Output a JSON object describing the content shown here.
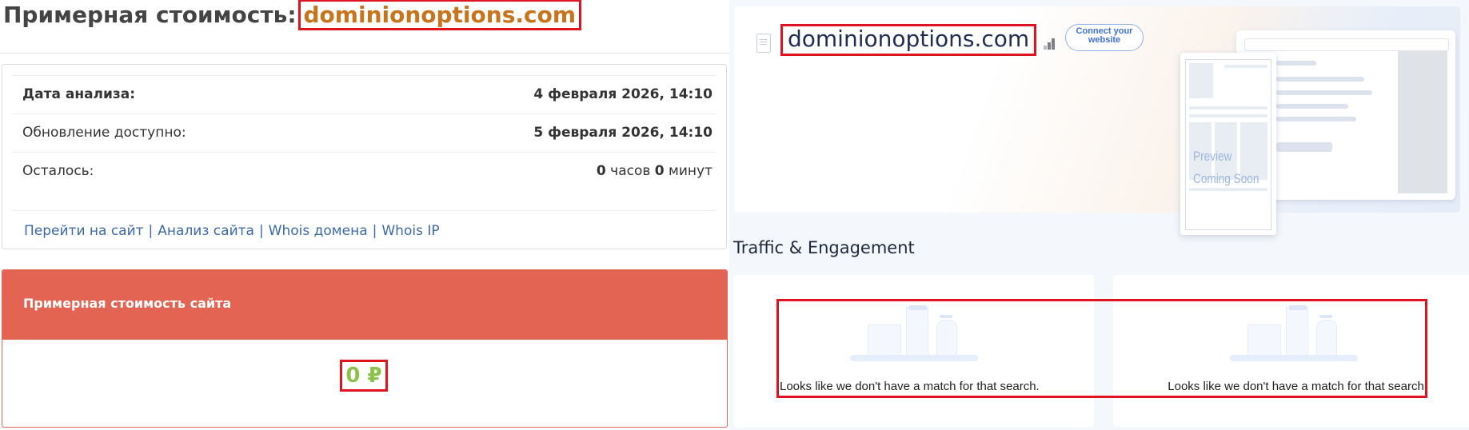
{
  "left_panel": {
    "title_prefix": "Примерная стоимость:",
    "title_domain": "dominionoptions.com",
    "info": {
      "rows": [
        {
          "label": "Дата анализа:",
          "value": "4 февраля 2026, 14:10"
        },
        {
          "label": "Обновление доступно:",
          "value": "5 февраля 2026, 14:10"
        }
      ],
      "remaining_label": "Осталось:",
      "remaining_hours": "0",
      "remaining_hours_unit": "часов",
      "remaining_minutes": "0",
      "remaining_minutes_unit": "минут"
    },
    "links": [
      "Перейти на сайт",
      "Анализ сайта",
      "Whois домена",
      "Whois IP"
    ],
    "link_separator": "|",
    "cost_card": {
      "header": "Примерная стоимость сайта",
      "value": "0 ₽"
    }
  },
  "right_panel": {
    "domain": "dominionoptions.com",
    "connect_button": "Connect your website",
    "preview_text_line1": "Preview",
    "preview_text_line2": "Coming Soon",
    "section_title": "Traffic & Engagement",
    "cards": [
      {
        "message": "Looks like we don't have a match for that search."
      },
      {
        "message": "Looks like we don't have a match for that search."
      }
    ]
  },
  "colors": {
    "title_domain": "#c8741c",
    "highlight_border": "#e0141e",
    "cost_header_bg": "#e46454",
    "cost_value": "#8bc34a",
    "link": "#3c6aa8"
  },
  "icons": [
    "doc-icon",
    "signal-icon",
    "empty-chart-illustration-icon"
  ]
}
